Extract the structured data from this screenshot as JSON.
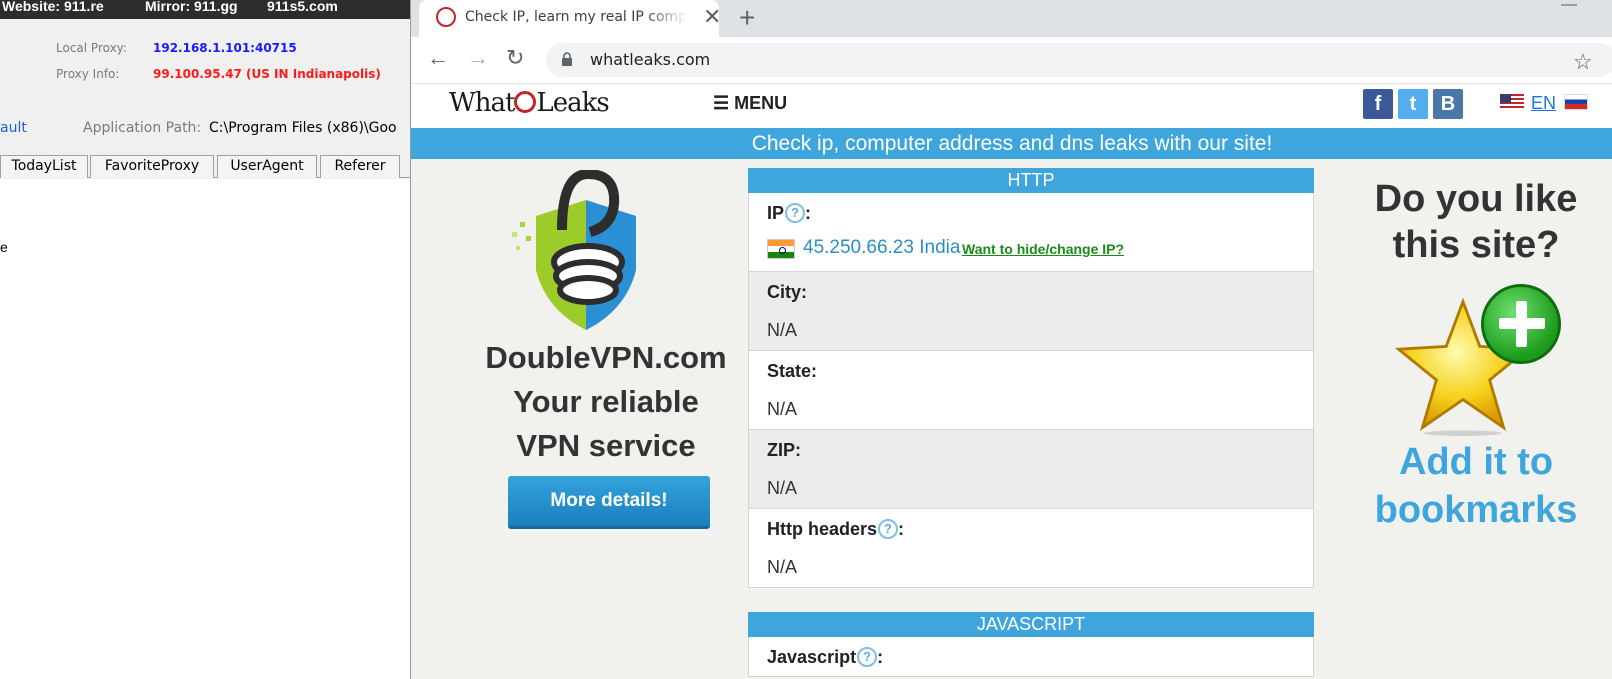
{
  "bg_app": {
    "title_website": "Website: 911.re",
    "title_mirror": "Mirror: 911.gg",
    "title_alt": "911s5.com",
    "local_proxy_label": "Local Proxy:",
    "local_proxy_value": "192.168.1.101:40715",
    "proxy_info_label": "Proxy Info:",
    "proxy_info_value": "99.100.95.47 (US IN Indianapolis)",
    "default_link": "ault",
    "app_path_label": "Application Path:",
    "app_path_value": "C:\\Program Files (x86)\\Goo",
    "tabs": [
      "TodayList",
      "FavoriteProxy",
      "UserAgent",
      "Referer"
    ],
    "body_text": "e",
    "colors": {
      "local_proxy": "#1a1aff",
      "proxy_info": "#ff1a1a"
    }
  },
  "browser": {
    "tab_title": "Check IP, learn my real IP computer address",
    "close_glyph": "✕",
    "new_tab_glyph": "+",
    "minimize_glyph": "—",
    "back_glyph": "←",
    "forward_glyph": "→",
    "reload_glyph": "↻",
    "url": "whatleaks.com",
    "bookmark_glyph": "☆"
  },
  "site": {
    "logo_pre": "What",
    "logo_post": "Leaks",
    "menu": "☰ MENU",
    "social": [
      "f",
      "t",
      "B"
    ],
    "lang": "EN",
    "banner": "Check ip, computer address and dns leaks with our site!",
    "ad_left": {
      "line1": "DoubleVPN.com",
      "line2": "Your reliable",
      "line3": "VPN service",
      "button": "More details!"
    },
    "http_header": "HTTP",
    "ip_label": "IP",
    "qmark": "?",
    "colon": ":",
    "ip_value": "45.250.66.23 India",
    "ip_link": "Want to hide/change IP?",
    "city_label": "City:",
    "city_value": "N/A",
    "state_label": "State:",
    "state_value": "N/A",
    "zip_label": "ZIP:",
    "zip_value": "N/A",
    "headers_label": "Http headers",
    "headers_value": "N/A",
    "js_header": "JAVASCRIPT",
    "js_label": "Javascript",
    "ad_right": {
      "line1": "Do you like",
      "line2": "this site?",
      "line3": "Add it to",
      "line4": "bookmarks"
    },
    "colors": {
      "accent": "#3ea6dc",
      "link_green": "#1a8a1a",
      "ip_blue": "#2a8fc9"
    }
  }
}
